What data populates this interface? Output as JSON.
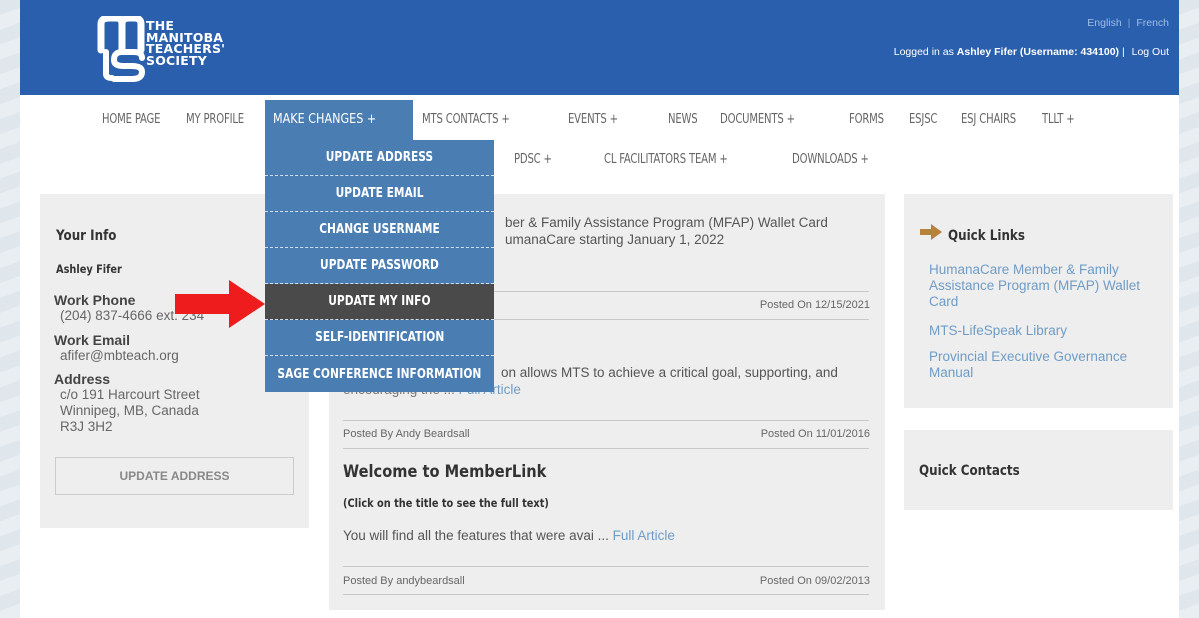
{
  "header": {
    "logo_lines": [
      "THE",
      "MANITOBA",
      "TEACHERS'",
      "SOCIETY"
    ],
    "lang_english": "English",
    "lang_sep": "|",
    "lang_french": "French",
    "login_prefix": "Logged in as",
    "login_user": "Ashley Fifer (Username: 434100)",
    "login_sep": "|",
    "logout": "Log Out",
    "brand_color": "#2a5fae"
  },
  "nav": {
    "row1": [
      "HOME PAGE",
      "MY PROFILE",
      "MAKE CHANGES +",
      "MTS CONTACTS +",
      "EVENTS +",
      "NEWS",
      "DOCUMENTS +",
      "FORMS",
      "ESJSC",
      "ESJ CHAIRS",
      "TLLT +"
    ],
    "row2": [
      "PDSC +",
      "CL FACILITATORS TEAM +",
      "DOWNLOADS +"
    ]
  },
  "dropdown": {
    "items": [
      "UPDATE ADDRESS",
      "UPDATE EMAIL",
      "CHANGE USERNAME",
      "UPDATE PASSWORD",
      "UPDATE MY INFO",
      "SELF-IDENTIFICATION",
      "SAGE CONFERENCE INFORMATION"
    ],
    "hovered": "UPDATE MY INFO"
  },
  "your_info": {
    "title": "Your Info",
    "name": "Ashley Fifer",
    "work_phone_label": "Work Phone",
    "work_phone": "(204) 837-4666 ext. 234",
    "work_email_label": "Work Email",
    "work_email": "afifer@mbteach.org",
    "address_label": "Address",
    "address_lines": [
      "c/o 191 Harcourt Street",
      "Winnipeg, MB, Canada",
      "R3J 3H2"
    ],
    "update_button": "UPDATE ADDRESS"
  },
  "articles": {
    "a1_link_line1": "ber & Family Assistance Program (MFAP) Wallet Card",
    "a1_line2": "umanaCare starting January 1, 2022",
    "a1_posted_on": "Posted On 12/15/2021",
    "a2_text": "on allows MTS to achieve a critical goal, supporting, and",
    "a2_text2_prefix": "encouraging the ...",
    "a2_full_article": "Full Article",
    "a2_posted_by": "Posted By Andy Beardsall",
    "a2_posted_on": "Posted On 11/01/2016",
    "a3_title": "Welcome to MemberLink",
    "a3_subtitle": "(Click on the title to see the full text)",
    "a3_text": "You will find all the features that were avai ...",
    "a3_full_article": "Full Article",
    "a3_posted_by": "Posted By andybeardsall",
    "a3_posted_on": "Posted On 09/02/2013"
  },
  "quick_links": {
    "title": "Quick Links",
    "links": [
      "HumanaCare Member & Family Assistance Program (MFAP) Wallet Card",
      "MTS-LifeSpeak Library",
      "Provincial Executive Governance Manual"
    ]
  },
  "quick_contacts": {
    "title": "Quick Contacts"
  }
}
